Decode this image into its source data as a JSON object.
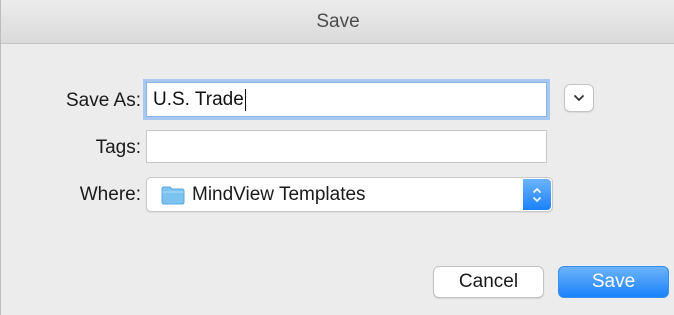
{
  "window": {
    "title": "Save"
  },
  "form": {
    "save_as_label": "Save As:",
    "save_as_value": "U.S. Trade",
    "tags_label": "Tags:",
    "tags_value": "",
    "where_label": "Where:",
    "where_value": "MindView Templates"
  },
  "icons": {
    "disclosure": "chevron-down-icon",
    "location": "folder-icon",
    "popup_arrows": "updown-arrows-icon"
  },
  "buttons": {
    "cancel_label": "Cancel",
    "save_label": "Save"
  },
  "colors": {
    "accent": "#1a82fb",
    "folder": "#7cc3f0",
    "focus_ring": "#a9c8f0"
  }
}
